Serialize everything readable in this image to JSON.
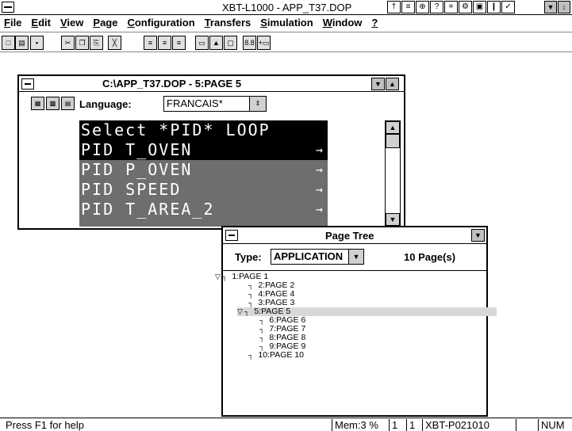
{
  "window": {
    "title": "XBT-L1000 - APP_T37.DOP",
    "title_icons": [
      "†",
      "≡",
      "⊕",
      "?",
      "⌗",
      "⚙",
      "▣",
      "❙",
      "✓"
    ],
    "min_icon": "▼",
    "max_icon": "↕"
  },
  "menu": [
    {
      "label": "File"
    },
    {
      "label": "Edit"
    },
    {
      "label": "View"
    },
    {
      "label": "Page"
    },
    {
      "label": "Configuration"
    },
    {
      "label": "Transfers"
    },
    {
      "label": "Simulation"
    },
    {
      "label": "Window"
    },
    {
      "label": "?"
    }
  ],
  "toolbar": [
    {
      "name": "new-icon",
      "glyph": "□"
    },
    {
      "name": "open-icon",
      "glyph": "▤"
    },
    {
      "name": "save-icon",
      "glyph": "▪"
    },
    {
      "name": "cut-icon",
      "glyph": "✂"
    },
    {
      "name": "copy-icon",
      "glyph": "❐"
    },
    {
      "name": "paste-icon",
      "glyph": "⎘"
    },
    {
      "name": "delete-icon",
      "glyph": "╳"
    },
    {
      "name": "align-left-icon",
      "glyph": "≡"
    },
    {
      "name": "align-center-icon",
      "glyph": "≡"
    },
    {
      "name": "align-right-icon",
      "glyph": "≡"
    },
    {
      "name": "frame-icon",
      "glyph": "▭"
    },
    {
      "name": "warning-icon",
      "glyph": "▲"
    },
    {
      "name": "field-icon",
      "glyph": "▢"
    },
    {
      "name": "variable-icon",
      "glyph": "8.8"
    },
    {
      "name": "link-icon",
      "glyph": "+▭"
    }
  ],
  "doc": {
    "title": "C:\\APP_T37.DOP - 5:PAGE 5",
    "language_label": "Language:",
    "language_value": "FRANCAIS*",
    "lcd_header": "Select  *PID*  LOOP",
    "lcd_rows": [
      "PID T_OVEN",
      "PID P_OVEN",
      "PID SPEED",
      "PID T_AREA_2"
    ],
    "lcd_arrow": "→"
  },
  "tree": {
    "title": "Page Tree",
    "type_label": "Type:",
    "type_value": "APPLICATION",
    "page_count": "10 Page(s)",
    "items": [
      {
        "label": "1:PAGE 1",
        "level": 0,
        "expanded": true
      },
      {
        "label": "2:PAGE 2",
        "level": 1
      },
      {
        "label": "4:PAGE 4",
        "level": 1
      },
      {
        "label": "3:PAGE 3",
        "level": 1
      },
      {
        "label": "5:PAGE 5",
        "level": 1,
        "expanded": true,
        "selected": true
      },
      {
        "label": "6:PAGE 6",
        "level": 2
      },
      {
        "label": "7:PAGE 7",
        "level": 2
      },
      {
        "label": "8:PAGE 8",
        "level": 2
      },
      {
        "label": "9:PAGE 9",
        "level": 2
      },
      {
        "label": "10:PAGE 10",
        "level": 1
      }
    ]
  },
  "status": {
    "help": "Press F1 for help",
    "mem": "Mem:3 %",
    "f1": "1",
    "f2": "1",
    "version": "XBT-P021010",
    "blank": "",
    "num": "NUM"
  }
}
